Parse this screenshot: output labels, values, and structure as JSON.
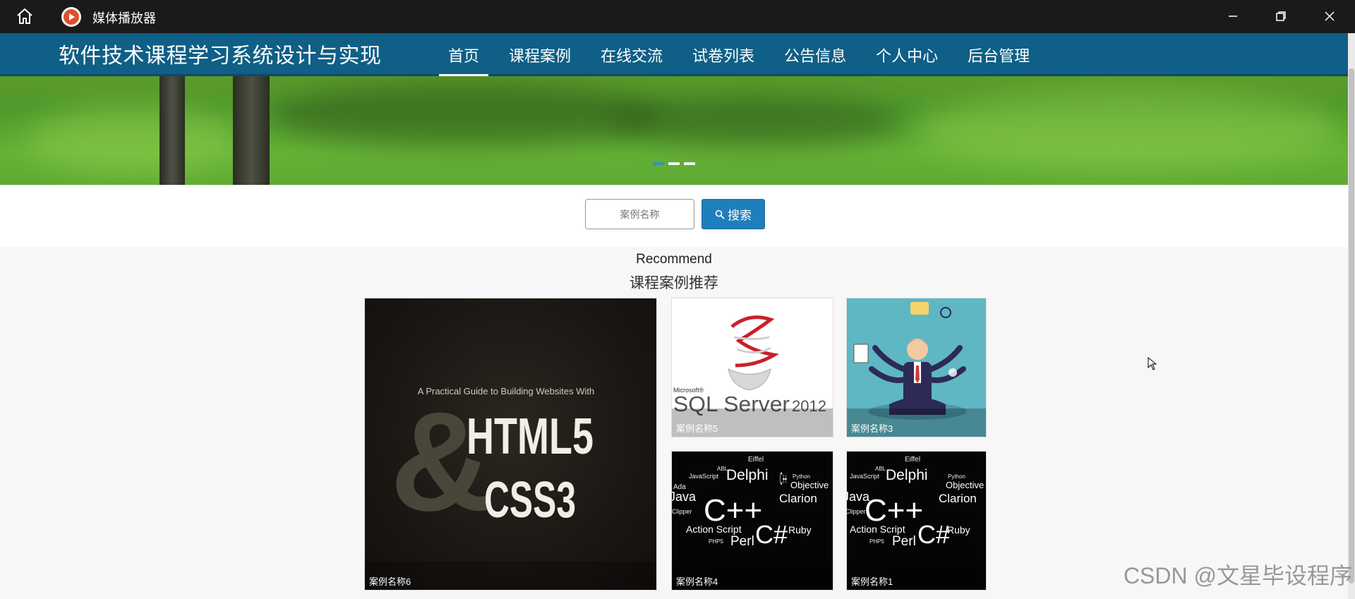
{
  "window": {
    "title": "媒体播放器",
    "icons": [
      "home-icon",
      "media-player-icon",
      "minimize-icon",
      "restore-icon",
      "close-icon"
    ]
  },
  "site": {
    "title": "软件技术课程学习系统设计与实现"
  },
  "nav": {
    "items": [
      {
        "label": "首页",
        "active": true
      },
      {
        "label": "课程案例",
        "active": false
      },
      {
        "label": "在线交流",
        "active": false
      },
      {
        "label": "试卷列表",
        "active": false
      },
      {
        "label": "公告信息",
        "active": false
      },
      {
        "label": "个人中心",
        "active": false
      },
      {
        "label": "后台管理",
        "active": false
      }
    ]
  },
  "search": {
    "placeholder": "案例名称",
    "button_label": "搜索"
  },
  "recommend": {
    "title_en": "Recommend",
    "title_cn": "课程案例推荐",
    "cards": [
      {
        "caption": "案例名称6",
        "image_text_small": "A Practical Guide to Building Websites With",
        "image_text_main": "HTML5",
        "image_text_main2": "CSS3",
        "image_text_amp": "&"
      },
      {
        "caption": "案例名称5",
        "image_text_brand": "Microsoft®",
        "image_text_main": "SQL Server",
        "image_text_ver": "2012"
      },
      {
        "caption": "案例名称3"
      },
      {
        "caption": "案例名称4"
      },
      {
        "caption": "案例名称1"
      }
    ]
  },
  "word_cloud": {
    "words": [
      "Delphi",
      "C++",
      "C#",
      "Clarion",
      "Objective",
      "Ruby",
      "Action Script",
      "Perl",
      "Java",
      "JavaScript",
      "Python",
      "Eiffel",
      "Ada",
      "Clipper",
      "PHP5",
      "ABL"
    ]
  },
  "watermark": "CSDN @文星毕设程序",
  "colors": {
    "titlebar": "#1a1a1a",
    "navbar": "#0f5f86",
    "search_button": "#1e7fbc",
    "banner_grass": "#5faa34"
  }
}
